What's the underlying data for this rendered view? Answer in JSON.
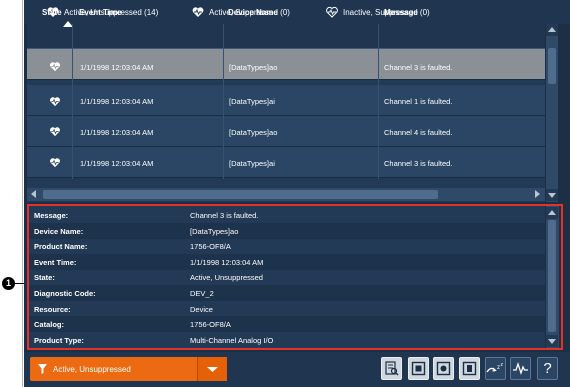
{
  "colors": {
    "accent": "#ec6a11",
    "highlight_border": "#e2332b",
    "panel": "#223a56",
    "row_selected": "#8b9097"
  },
  "callout": {
    "number": "1"
  },
  "filters": [
    {
      "label": "Active, Unsuppressed (14)",
      "icon": "heart-active-icon"
    },
    {
      "label": "Active, Suppressed (0)",
      "icon": "heart-active-icon"
    },
    {
      "label": "Inactive, Suppressed (0)",
      "icon": "heart-outline-icon"
    }
  ],
  "table": {
    "columns": [
      "State",
      "Event Time",
      "Device Name",
      "Message"
    ],
    "rows": [
      {
        "time": "1/1/1998 12:03:04 AM",
        "device": "[DataTypes]ao",
        "message": "Channel 3 is faulted."
      },
      {
        "time": "1/1/1998 12:03:04 AM",
        "device": "[DataTypes]ai",
        "message": "Channel 1 is faulted."
      },
      {
        "time": "1/1/1998 12:03:04 AM",
        "device": "[DataTypes]ao",
        "message": "Channel 4 is faulted."
      },
      {
        "time": "1/1/1998 12:03:04 AM",
        "device": "[DataTypes]ai",
        "message": "Channel 3 is faulted."
      }
    ]
  },
  "details": [
    {
      "label": "Message:",
      "value": "Channel 3 is faulted."
    },
    {
      "label": "Device Name:",
      "value": "[DataTypes]ao"
    },
    {
      "label": "Product Name:",
      "value": "1756-OF8/A"
    },
    {
      "label": "Event Time:",
      "value": "1/1/1998 12:03:04 AM"
    },
    {
      "label": "State:",
      "value": "Active, Unsuppressed"
    },
    {
      "label": "Diagnostic Code:",
      "value": "DEV_2"
    },
    {
      "label": "Resource:",
      "value": "Device"
    },
    {
      "label": "Catalog:",
      "value": "1756-OF8/A"
    },
    {
      "label": "Product Type:",
      "value": "Multi-Channel Analog I/O"
    }
  ],
  "bottom": {
    "filter_dropdown": "Active, Unsuppressed",
    "tools": [
      "details-icon",
      "acknowledge-icon",
      "acknowledge-all-icon",
      "reset-icon",
      "sleep-icon",
      "trend-icon",
      "help-icon"
    ],
    "help_glyph": "?",
    "sleep_glyph": "z"
  }
}
